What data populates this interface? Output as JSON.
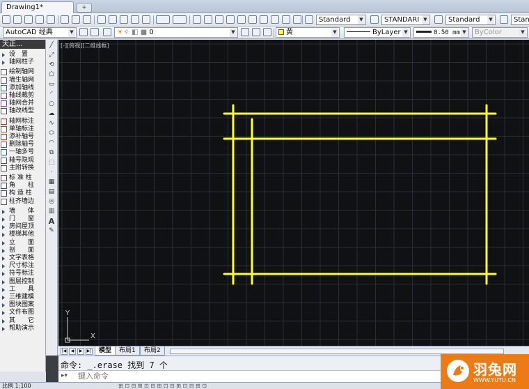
{
  "document_tab": {
    "title": "Drawing1*"
  },
  "toolbar": {
    "text_style": "Standard",
    "dim_style": "STANDARI",
    "table_style": "Standard",
    "mleader_style": "Stan",
    "workspace": "AutoCAD 经典",
    "layer": "0",
    "color": "黄",
    "linetype": "ByLayer",
    "lineweight": "0.50 mm",
    "plotstyle": "ByColor"
  },
  "left_panel": {
    "title": "天正...",
    "items": [
      {
        "label": "设　置",
        "icon": "triangle"
      },
      {
        "label": "轴网柱子",
        "icon": "triangle"
      },
      {
        "label": "绘制轴网",
        "icon": "grid-icon"
      },
      {
        "label": "墙生轴网",
        "icon": "grid-icon"
      },
      {
        "label": "添加轴线",
        "icon": "axis-icon"
      },
      {
        "label": "轴线裁剪",
        "icon": "trim-icon"
      },
      {
        "label": "轴网合并",
        "icon": "merge-icon"
      },
      {
        "label": "轴改线型",
        "icon": "linetype-icon"
      },
      {
        "label": "轴网标注",
        "icon": "dim-icon"
      },
      {
        "label": "单轴标注",
        "icon": "dim-icon"
      },
      {
        "label": "添补轴号",
        "icon": "number-icon"
      },
      {
        "label": "删除轴号",
        "icon": "delete-icon"
      },
      {
        "label": "一轴多号",
        "icon": "multi-icon"
      },
      {
        "label": "轴号隐现",
        "icon": "eye-icon"
      },
      {
        "label": "主附转换",
        "icon": "swap-icon"
      },
      {
        "label": "标 准 柱",
        "icon": "column-icon"
      },
      {
        "label": "角　　柱",
        "icon": "column-icon"
      },
      {
        "label": "构 造 柱",
        "icon": "column-icon"
      },
      {
        "label": "柱齐墙边",
        "icon": "align-icon"
      },
      {
        "label": "墙　　体",
        "icon": "triangle"
      },
      {
        "label": "门　　窗",
        "icon": "triangle"
      },
      {
        "label": "房间屋顶",
        "icon": "triangle"
      },
      {
        "label": "楼梯其他",
        "icon": "triangle"
      },
      {
        "label": "立　　面",
        "icon": "triangle"
      },
      {
        "label": "剖　　面",
        "icon": "triangle"
      },
      {
        "label": "文字表格",
        "icon": "triangle"
      },
      {
        "label": "尺寸标注",
        "icon": "triangle"
      },
      {
        "label": "符号标注",
        "icon": "triangle"
      },
      {
        "label": "图层控制",
        "icon": "triangle"
      },
      {
        "label": "工　　具",
        "icon": "triangle"
      },
      {
        "label": "三维建模",
        "icon": "triangle"
      },
      {
        "label": "图块图案",
        "icon": "triangle"
      },
      {
        "label": "文件布图",
        "icon": "triangle"
      },
      {
        "label": "其　　它",
        "icon": "triangle"
      },
      {
        "label": "帮助演示",
        "icon": "triangle"
      }
    ]
  },
  "viewport": {
    "label": "[-][俯视][二维线框]",
    "ucs_x": "X",
    "ucs_y": "Y"
  },
  "layout_tabs": [
    "模型",
    "布局1",
    "布局2"
  ],
  "command": {
    "history": "命令: _.erase 找到 7 个",
    "placeholder": "键入命令"
  },
  "statusbar": {
    "scale": "比例 1:100"
  },
  "watermark": {
    "brand": "羽兔网",
    "url": "WWW.YUTU.CN"
  },
  "colors": {
    "canvas": "#101113",
    "line": "#ffff22"
  }
}
